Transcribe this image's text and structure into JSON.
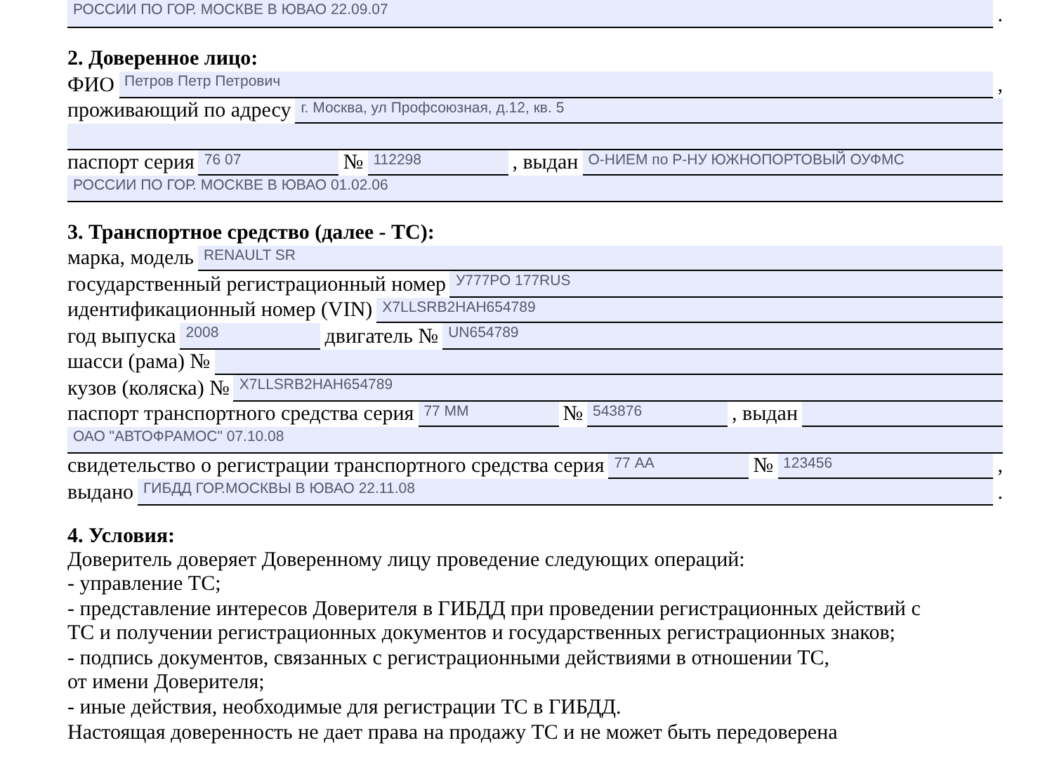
{
  "top_line": [
    {
      "kind": "field",
      "value": "РОССИИ ПО ГОР. МОСКВЕ В ЮВАО 22.09.07"
    },
    {
      "kind": "label",
      "text": "."
    }
  ],
  "sections": [
    {
      "heading": "2. Доверенное лицо:",
      "lines": [
        [
          {
            "kind": "label",
            "text": "ФИО"
          },
          {
            "kind": "field",
            "value": "Петров Петр Петрович"
          },
          {
            "kind": "label",
            "text": ","
          }
        ],
        [
          {
            "kind": "label",
            "text": "проживающий по адресу"
          },
          {
            "kind": "field",
            "value": "г. Москва, ул Профсоюзная, д.12, кв. 5"
          }
        ],
        [
          {
            "kind": "field"
          }
        ],
        [
          {
            "kind": "label",
            "text": "паспорт серия"
          },
          {
            "kind": "field",
            "value": "76 07"
          },
          {
            "kind": "label",
            "text": "№"
          },
          {
            "kind": "field",
            "value": "112298"
          },
          {
            "kind": "label",
            "text": ", выдан"
          },
          {
            "kind": "field",
            "value": "О-НИЕМ по Р-НУ ЮЖНОПОРТОВЫЙ ОУФМС"
          }
        ],
        [
          {
            "kind": "field",
            "value": "РОССИИ ПО ГОР. МОСКВЕ В ЮВАО 01.02.06"
          }
        ]
      ]
    },
    {
      "heading": "3. Транспортное средство (далее - ТС):",
      "lines": [
        [
          {
            "kind": "label",
            "text": "марка, модель"
          },
          {
            "kind": "field",
            "value": "RENAULT SR"
          }
        ],
        [
          {
            "kind": "label",
            "text": "государственный регистрационный номер"
          },
          {
            "kind": "field",
            "value": "У777РО 177RUS"
          }
        ],
        [
          {
            "kind": "label",
            "text": "идентификационный номер (VIN)"
          },
          {
            "kind": "field",
            "value": "X7LLSRB2HAH654789"
          }
        ],
        [
          {
            "kind": "label",
            "text": "год выпуска"
          },
          {
            "kind": "field",
            "value": "2008"
          },
          {
            "kind": "label",
            "text": "двигатель №"
          },
          {
            "kind": "field",
            "value": "UN654789"
          }
        ],
        [
          {
            "kind": "label",
            "text": "шасси (рама) №"
          },
          {
            "kind": "field"
          }
        ],
        [
          {
            "kind": "label",
            "text": "кузов (коляска) №"
          },
          {
            "kind": "field",
            "value": "X7LLSRB2HAH654789"
          }
        ],
        [
          {
            "kind": "label",
            "text": "паспорт транспортного средства серия"
          },
          {
            "kind": "field",
            "value": "77 ММ"
          },
          {
            "kind": "label",
            "text": "№"
          },
          {
            "kind": "field",
            "value": "543876"
          },
          {
            "kind": "label",
            "text": ", выдан"
          },
          {
            "kind": "field"
          }
        ],
        [
          {
            "kind": "field",
            "value": "ОАО \"АВТОФРАМОС\" 07.10.08"
          }
        ],
        [
          {
            "kind": "label",
            "text": "свидетельство о регистрации транспортного средства серия"
          },
          {
            "kind": "field",
            "value": "77 АА"
          },
          {
            "kind": "label",
            "text": "№"
          },
          {
            "kind": "field",
            "value": "123456"
          },
          {
            "kind": "label",
            "text": ","
          }
        ],
        [
          {
            "kind": "label",
            "text": "выдано"
          },
          {
            "kind": "field",
            "value": "ГИБДД ГОР.МОСКВЫ В ЮВАО 22.11.08"
          },
          {
            "kind": "label",
            "text": "."
          }
        ]
      ]
    }
  ],
  "conditions": {
    "heading": "4. Условия:",
    "lines": [
      "Доверитель доверяет Доверенному лицу проведение следующих операций:",
      "- управление ТС;",
      "- представление интересов Доверителя в ГИБДД при проведении регистрационных действий с",
      "ТС и получении регистрационных документов и государственных регистрационных знаков;",
      "- подпись документов, связанных с регистрационными действиями в отношении ТС,",
      "от имени Доверителя;",
      "- иные действия, необходимые для регистрации ТС в ГИБДД.",
      "Настоящая доверенность не дает права на продажу ТС и не может быть передоверена"
    ]
  }
}
